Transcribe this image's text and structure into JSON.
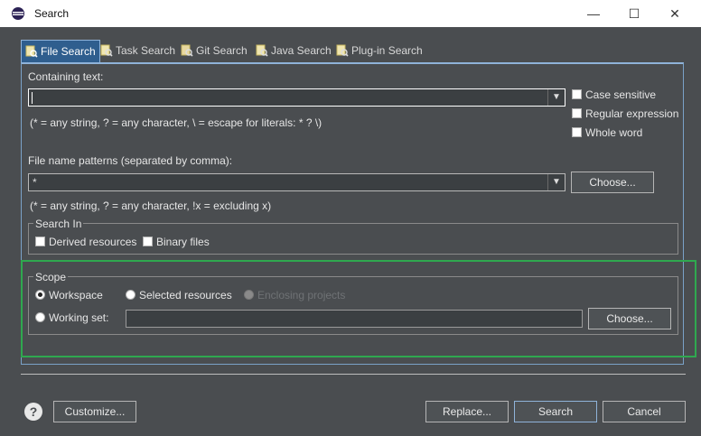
{
  "window": {
    "title": "Search",
    "minimize": "—",
    "maximize": "☐",
    "close": "✕"
  },
  "tabs": [
    {
      "label": "File Search",
      "icon": "file-search-icon"
    },
    {
      "label": "Task Search",
      "icon": "task-search-icon"
    },
    {
      "label": "Git Search",
      "icon": "git-search-icon"
    },
    {
      "label": "Java Search",
      "icon": "java-search-icon"
    },
    {
      "label": "Plug-in Search",
      "icon": "plugin-search-icon"
    }
  ],
  "containing": {
    "label": "Containing text:",
    "value": "",
    "hint": "(* = any string, ? = any character, \\ = escape for literals: * ? \\)",
    "case_sensitive": "Case sensitive",
    "regex": "Regular expression",
    "whole_word": "Whole word"
  },
  "patterns": {
    "label": "File name patterns (separated by comma):",
    "value": "*",
    "hint": "(* = any string, ? = any character, !x = excluding x)",
    "choose": "Choose..."
  },
  "search_in": {
    "legend": "Search In",
    "derived": "Derived resources",
    "binary": "Binary files"
  },
  "scope": {
    "legend": "Scope",
    "workspace": "Workspace",
    "selected": "Selected resources",
    "enclosing": "Enclosing projects",
    "working_set": "Working set:",
    "working_set_value": "",
    "choose": "Choose..."
  },
  "footer": {
    "help": "?",
    "customize": "Customize...",
    "replace": "Replace...",
    "search": "Search",
    "cancel": "Cancel"
  },
  "colors": {
    "accent": "#2f5e8e",
    "highlight": "#2fa84f",
    "background": "#4a4d50"
  }
}
